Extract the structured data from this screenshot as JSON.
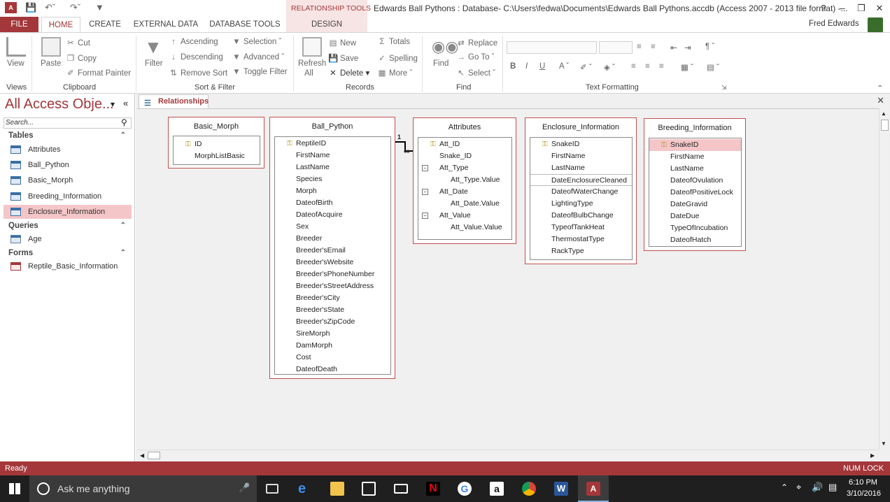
{
  "titlebar": {
    "context_tab_label": "RELATIONSHIP TOOLS",
    "window_title": "Edwards Ball Pythons : Database- C:\\Users\\fedwa\\Documents\\Edwards Ball Pythons.accdb (Access 2007 - 2013 file format) -...",
    "help": "?"
  },
  "tabs": {
    "file": "FILE",
    "home": "HOME",
    "create": "CREATE",
    "external_data": "EXTERNAL DATA",
    "database_tools": "DATABASE TOOLS",
    "design": "DESIGN",
    "user_name": "Fred Edwards"
  },
  "ribbon": {
    "views": {
      "view": "View",
      "group": "Views"
    },
    "clipboard": {
      "paste": "Paste",
      "cut": "Cut",
      "copy": "Copy",
      "format_painter": "Format Painter",
      "group": "Clipboard"
    },
    "sort_filter": {
      "filter": "Filter",
      "ascending": "Ascending",
      "descending": "Descending",
      "remove_sort": "Remove Sort",
      "selection": "Selection",
      "advanced": "Advanced",
      "toggle_filter": "Toggle Filter",
      "group": "Sort & Filter"
    },
    "records": {
      "refresh": "Refresh",
      "refresh2": "All",
      "new": "New",
      "save": "Save",
      "delete": "Delete",
      "totals": "Totals",
      "spelling": "Spelling",
      "more": "More",
      "group": "Records"
    },
    "find": {
      "find": "Find",
      "replace": "Replace",
      "goto": "Go To",
      "select": "Select",
      "group": "Find"
    },
    "text_formatting": {
      "bold": "B",
      "italic": "I",
      "underline": "U",
      "group": "Text Formatting"
    }
  },
  "nav": {
    "title": "All Access Obje...",
    "search_placeholder": "Search...",
    "tables_header": "Tables",
    "tables": [
      "Attributes",
      "Ball_Python",
      "Basic_Morph",
      "Breeding_Information",
      "Enclosure_Information"
    ],
    "queries_header": "Queries",
    "queries": [
      "Age"
    ],
    "forms_header": "Forms",
    "forms": [
      "Reptile_Basic_Information"
    ]
  },
  "document": {
    "tab_label": "Relationships",
    "relationship_one": "1",
    "relationship_many": "∞"
  },
  "tables": {
    "basic_morph": {
      "title": "Basic_Morph",
      "fields": [
        "ID",
        "MorphListBasic"
      ]
    },
    "ball_python": {
      "title": "Ball_Python",
      "fields": [
        "ReptileID",
        "FirstName",
        "LastName",
        "Species",
        "Morph",
        "DateofBirth",
        "DateofAcquire",
        "Sex",
        "Breeder",
        "Breeder'sEmail",
        "Breeder'sWebsite",
        "Breeder'sPhoneNumber",
        "Breeder'sStreetAddress",
        "Breeder'sCity",
        "Breeder'sState",
        "Breeder'sZipCode",
        "SireMorph",
        "DamMorph",
        "Cost",
        "DateofDeath"
      ]
    },
    "attributes": {
      "title": "Attributes",
      "fields": [
        "Att_ID",
        "Snake_ID",
        "Att_Type",
        "Att_Type.Value",
        "Att_Date",
        "Att_Date.Value",
        "Att_Value",
        "Att_Value.Value"
      ]
    },
    "enclosure": {
      "title": "Enclosure_Information",
      "fields": [
        "SnakeID",
        "FirstName",
        "LastName",
        "DateEnclosureCleaned",
        "DateofWaterChange",
        "LightingType",
        "DateofBulbChange",
        "TypeofTankHeat",
        "ThermostatType",
        "RackType"
      ]
    },
    "breeding": {
      "title": "Breeding_Information",
      "fields": [
        "SnakeID",
        "FirstName",
        "LastName",
        "DateofOvulation",
        "DateofPositiveLock",
        "DateGravid",
        "DateDue",
        "TypeOfIncubation",
        "DateofHatch"
      ]
    }
  },
  "status": {
    "left": "Ready",
    "right": "NUM LOCK"
  },
  "taskbar": {
    "search_placeholder": "Ask me anything",
    "time": "6:10 PM",
    "date": "3/10/2016"
  },
  "colors": {
    "accent": "#a4373a",
    "table_border": "#c0504d",
    "selected_row": "#f4c6c8"
  }
}
